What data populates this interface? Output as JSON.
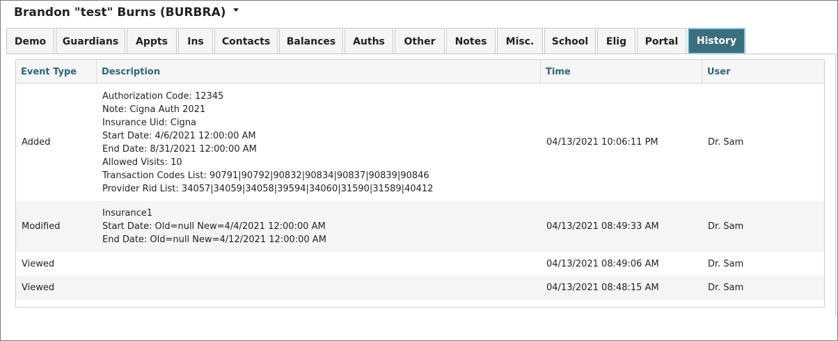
{
  "header": {
    "patient_name": "Brandon \"test\" Burns (BURBRA)"
  },
  "tabs": [
    {
      "label": "Demo"
    },
    {
      "label": "Guardians"
    },
    {
      "label": "Appts"
    },
    {
      "label": "Ins"
    },
    {
      "label": "Contacts"
    },
    {
      "label": "Balances"
    },
    {
      "label": "Auths"
    },
    {
      "label": "Other"
    },
    {
      "label": "Notes"
    },
    {
      "label": "Misc."
    },
    {
      "label": "School"
    },
    {
      "label": "Elig"
    },
    {
      "label": "Portal"
    },
    {
      "label": "History"
    }
  ],
  "active_tab": "History",
  "table": {
    "columns": [
      "Event Type",
      "Description",
      "Time",
      "User"
    ],
    "rows": [
      {
        "event_type": "Added",
        "description": [
          "Authorization Code: 12345",
          "Note: Cigna Auth 2021",
          "Insurance Uid: Cigna",
          "Start Date: 4/6/2021 12:00:00 AM",
          "End Date: 8/31/2021 12:00:00 AM",
          "Allowed Visits: 10",
          "Transaction Codes List: 90791|90792|90832|90834|90837|90839|90846",
          "Provider Rid List: 34057|34059|34058|39594|34060|31590|31589|40412"
        ],
        "time": "04/13/2021 10:06:11 PM",
        "user": "Dr. Sam"
      },
      {
        "event_type": "Modified",
        "description": [
          "Insurance1",
          "Start Date: Old=null New=4/4/2021 12:00:00 AM",
          "End Date: Old=null New=4/12/2021 12:00:00 AM"
        ],
        "time": "04/13/2021 08:49:33 AM",
        "user": "Dr. Sam"
      },
      {
        "event_type": "Viewed",
        "description": [],
        "time": "04/13/2021 08:49:06 AM",
        "user": "Dr. Sam"
      },
      {
        "event_type": "Viewed",
        "description": [],
        "time": "04/13/2021 08:48:15 AM",
        "user": "Dr. Sam"
      }
    ]
  },
  "colors": {
    "active_tab_bg": "#3b6f80",
    "active_tab_border": "#8ec9e6",
    "column_header_text": "#2f6578",
    "alt_row_bg": "#f5f5f5"
  }
}
